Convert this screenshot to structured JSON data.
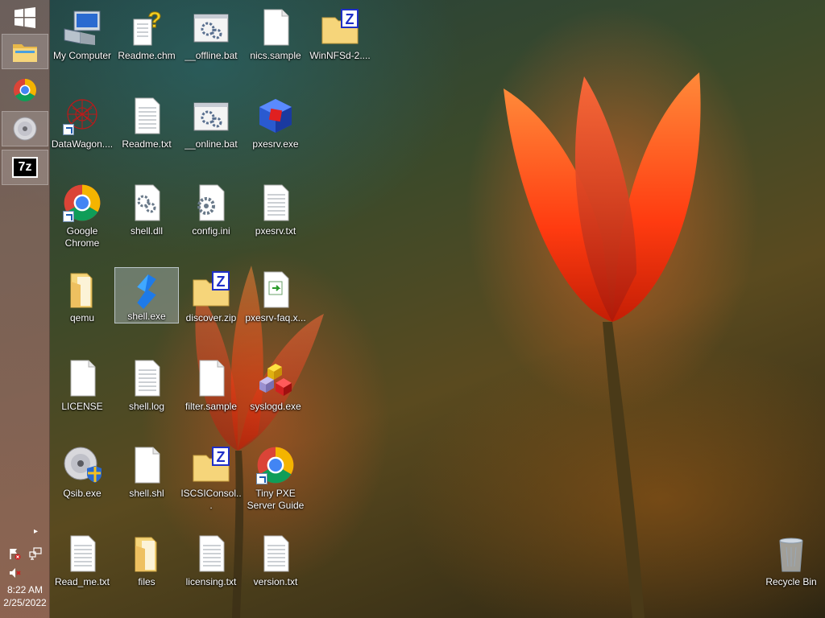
{
  "taskbar": {
    "items": [
      {
        "name": "start",
        "icon": "windows-logo-icon"
      },
      {
        "name": "file-explorer",
        "icon": "folder-icon"
      },
      {
        "name": "chrome",
        "icon": "chrome-icon"
      },
      {
        "name": "cd-drive",
        "icon": "disc-icon"
      },
      {
        "name": "7zip",
        "icon": "7zip-icon",
        "label": "7z"
      }
    ],
    "tray_arrow": "▸",
    "time": "8:22 AM",
    "date": "2/25/2022"
  },
  "desktop": {
    "icons": [
      {
        "label": "My Computer",
        "icon": "computer-icon"
      },
      {
        "label": "Readme.chm",
        "icon": "help-file-icon"
      },
      {
        "label": "__offline.bat",
        "icon": "batch-file-icon"
      },
      {
        "label": "nics.sample",
        "icon": "blank-file-icon"
      },
      {
        "label": "WinNFSd-2....",
        "icon": "zip-folder-icon",
        "zip_letter": "Z"
      },
      {
        "label": "DataWagon....",
        "icon": "network-app-icon"
      },
      {
        "label": "Readme.txt",
        "icon": "text-file-icon"
      },
      {
        "label": "__online.bat",
        "icon": "batch-file-icon"
      },
      {
        "label": "pxesrv.exe",
        "icon": "cube-app-icon"
      },
      {
        "label": "Google Chrome",
        "icon": "chrome-icon"
      },
      {
        "label": "shell.dll",
        "icon": "settings-file-icon"
      },
      {
        "label": "config.ini",
        "icon": "settings-file-icon"
      },
      {
        "label": "pxesrv.txt",
        "icon": "text-file-icon"
      },
      {
        "label": "qemu",
        "icon": "folder-icon"
      },
      {
        "label": "shell.exe",
        "icon": "shell-app-icon"
      },
      {
        "label": "discover.zip",
        "icon": "zip-folder-icon",
        "zip_letter": "Z"
      },
      {
        "label": "pxesrv-faq.x...",
        "icon": "html-file-icon"
      },
      {
        "label": "LICENSE",
        "icon": "blank-file-icon"
      },
      {
        "label": "shell.log",
        "icon": "text-file-icon"
      },
      {
        "label": "filter.sample",
        "icon": "blank-file-icon"
      },
      {
        "label": "syslogd.exe",
        "icon": "blocks-app-icon"
      },
      {
        "label": "Qsib.exe",
        "icon": "disc-shield-icon"
      },
      {
        "label": "shell.shl",
        "icon": "blank-file-icon"
      },
      {
        "label": "ISCSIConsol...",
        "icon": "zip-folder-icon",
        "zip_letter": "Z"
      },
      {
        "label": "Tiny PXE Server Guide",
        "icon": "chrome-icon"
      },
      {
        "label": "Read_me.txt",
        "icon": "text-file-icon"
      },
      {
        "label": "files",
        "icon": "folder-icon"
      },
      {
        "label": "licensing.txt",
        "icon": "text-file-icon"
      },
      {
        "label": "version.txt",
        "icon": "text-file-icon"
      },
      {
        "label": "Recycle Bin",
        "icon": "recycle-bin-icon"
      }
    ]
  },
  "colors": {
    "selection": "#c8d7e6",
    "folder": "#f3d27a",
    "zip_badge": "#1f2fc8"
  }
}
